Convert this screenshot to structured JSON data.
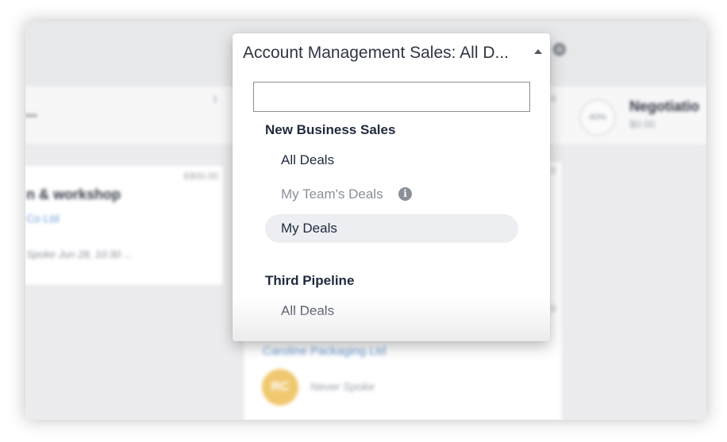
{
  "header": {
    "pipeline_selector_label": "Account Management Sales: All D...",
    "settings_icon": "gear-icon"
  },
  "board": {
    "stages": [
      {
        "title": "...",
        "count": "1"
      },
      {
        "count": "0"
      },
      {
        "percent": "40%",
        "title": "Negotiatio",
        "value": "$0.00"
      }
    ],
    "cards": [
      {
        "amount": "€800.00",
        "title": "n & workshop",
        "org": "Co Ltd",
        "last_activity": "Spoke Jun 28, 10:30 ..."
      },
      {
        "amount": "0",
        "amount2": "0",
        "org": "Caroline Packaging Ltd",
        "avatar_initials": "RC",
        "last_activity": "Never Spoke"
      }
    ]
  },
  "dropdown": {
    "search": {
      "value": "",
      "placeholder": ""
    },
    "groups": [
      {
        "title": "New Business Sales",
        "options": [
          {
            "label": "All Deals",
            "state": "normal"
          },
          {
            "label": "My Team's Deals",
            "state": "disabled",
            "icon": "info-icon"
          },
          {
            "label": "My Deals",
            "state": "selected"
          }
        ]
      },
      {
        "title": "Third Pipeline",
        "options": [
          {
            "label": "All Deals",
            "state": "normal"
          }
        ]
      }
    ]
  },
  "colors": {
    "heading_text": "#1f2a3d",
    "disabled_text": "#8a8f98",
    "selected_bg": "#eceef1",
    "link_blue": "#6c9bd2",
    "avatar_bg": "#f0c870"
  }
}
